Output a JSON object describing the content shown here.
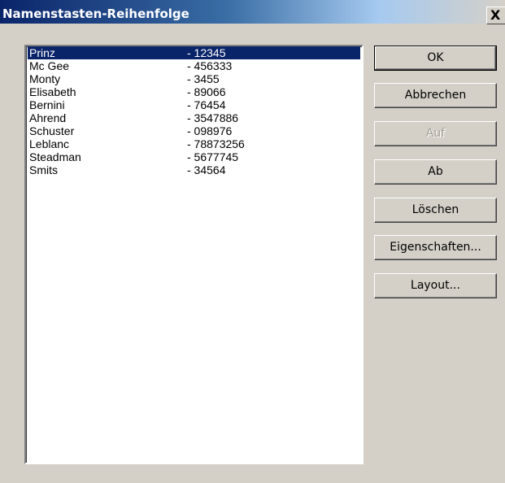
{
  "window": {
    "title": "Namenstasten-Reihenfolge",
    "close_glyph": "X"
  },
  "list": {
    "items": [
      {
        "name": "Prinz",
        "number": "- 12345",
        "selected": true
      },
      {
        "name": "Mc Gee",
        "number": "- 456333",
        "selected": false
      },
      {
        "name": "Monty",
        "number": "- 3455",
        "selected": false
      },
      {
        "name": "Elisabeth",
        "number": "- 89066",
        "selected": false
      },
      {
        "name": "Bernini",
        "number": "- 76454",
        "selected": false
      },
      {
        "name": "Ahrend",
        "number": "- 3547886",
        "selected": false
      },
      {
        "name": "Schuster",
        "number": "- 098976",
        "selected": false
      },
      {
        "name": "Leblanc",
        "number": "- 78873256",
        "selected": false
      },
      {
        "name": "Steadman",
        "number": "- 5677745",
        "selected": false
      },
      {
        "name": "Smits",
        "number": "- 34564",
        "selected": false
      }
    ]
  },
  "buttons": {
    "ok": "OK",
    "cancel": "Abbrechen",
    "up": "Auf",
    "down": "Ab",
    "delete": "Löschen",
    "properties": "Eigenschaften...",
    "layout": "Layout..."
  },
  "colors": {
    "dialog_face": "#d4d0c8",
    "title_bar": "#0a246a",
    "selection": "#0a246a",
    "disabled_text": "#a6a29a"
  }
}
